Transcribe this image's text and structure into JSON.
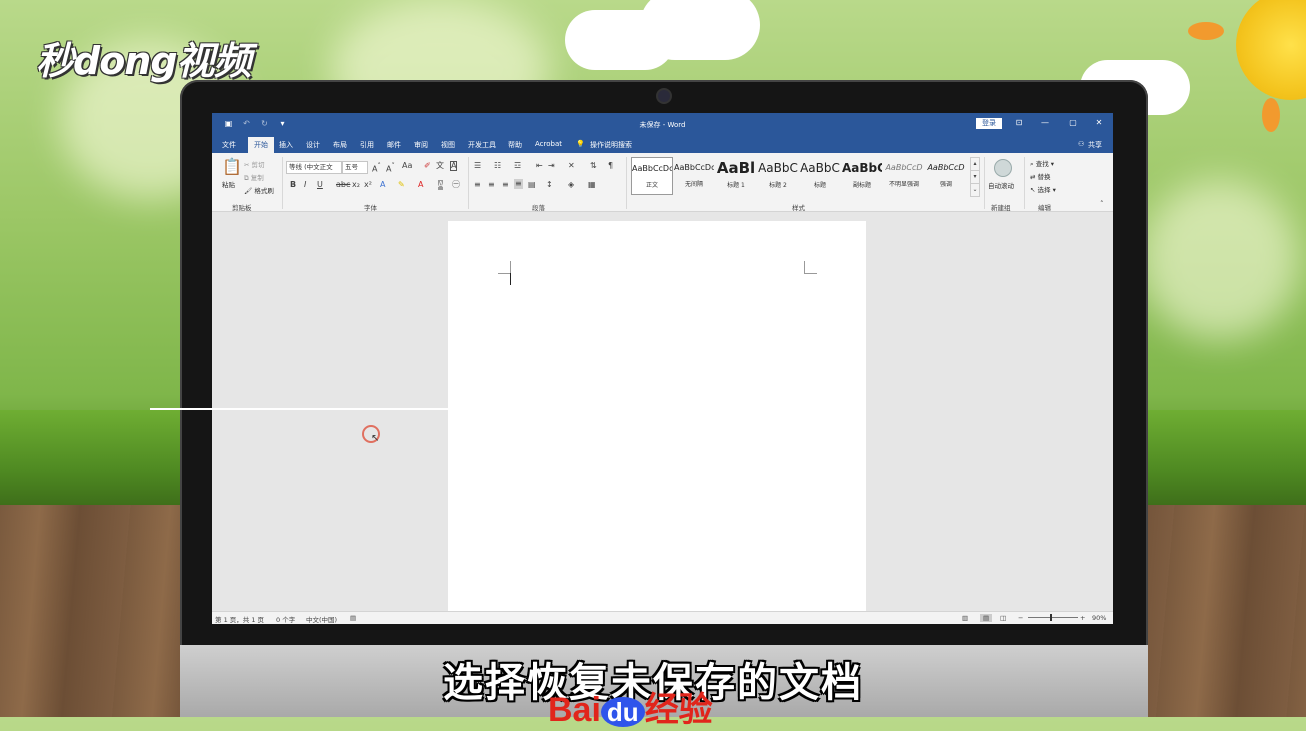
{
  "brand_logo": "秒dong视频",
  "subtitle": "选择恢复未保存的文档",
  "watermark": {
    "bai": "Bai",
    "du": "du",
    "jingyan": "经验"
  },
  "word": {
    "title": "未保存 - Word",
    "login_label": "登录",
    "share_label": "共享",
    "window_controls": {
      "minimize": "—",
      "restore": "▢",
      "close": "✕"
    },
    "tabs": [
      "文件",
      "开始",
      "插入",
      "设计",
      "布局",
      "引用",
      "邮件",
      "审阅",
      "视图",
      "开发工具",
      "帮助",
      "Acrobat"
    ],
    "active_tab": "开始",
    "tell_me": "操作说明搜索",
    "ribbon": {
      "clipboard": {
        "paste": "粘贴",
        "cut": "剪切",
        "copy": "复制",
        "format_painter": "格式刷",
        "label": "剪贴板"
      },
      "font": {
        "font_name": "等线 (中文正文",
        "font_size": "五号",
        "label": "字体"
      },
      "paragraph": {
        "label": "段落"
      },
      "styles": {
        "label": "样式",
        "items": [
          {
            "sample": "AaBbCcDc",
            "name": "正文"
          },
          {
            "sample": "AaBbCcDc",
            "name": "无间隔"
          },
          {
            "sample": "AaBl",
            "name": "标题 1"
          },
          {
            "sample": "AaBbC",
            "name": "标题 2"
          },
          {
            "sample": "AaBbC",
            "name": "标题"
          },
          {
            "sample": "AaBbC",
            "name": "副标题"
          },
          {
            "sample": "AaBbCcD",
            "name": "不明显强调"
          },
          {
            "sample": "AaBbCcD",
            "name": "强调"
          }
        ]
      },
      "new_group": {
        "auto_start": "自动滚动",
        "label": "新建组"
      },
      "editing": {
        "find": "查找",
        "replace": "替换",
        "select": "选择",
        "label": "编辑"
      }
    },
    "status": {
      "page": "第 1 页，共 1 页",
      "words": "0 个字",
      "language": "中文(中国)",
      "zoom": "90%"
    }
  }
}
